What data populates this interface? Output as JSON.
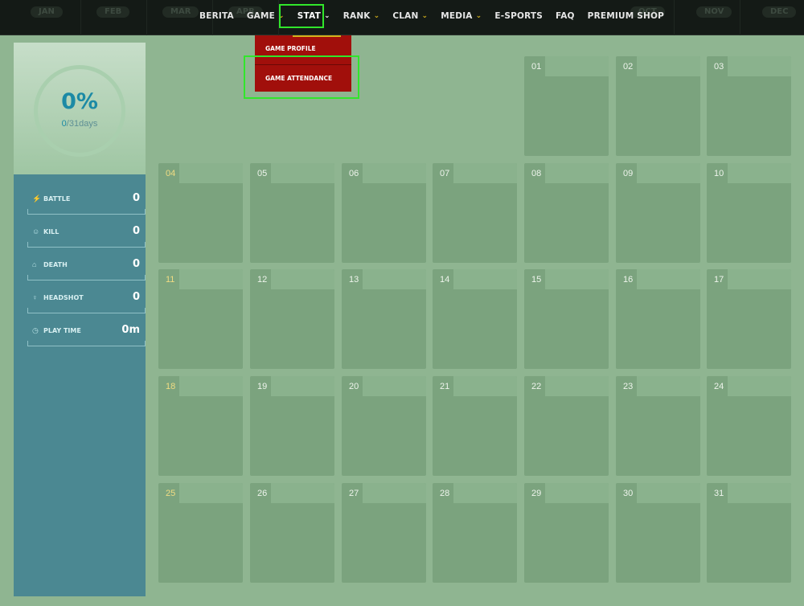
{
  "months": [
    "JAN",
    "FEB",
    "MAR",
    "APR",
    "MAY",
    "JUN",
    "JUL",
    "AUG",
    "SEP",
    "OCT",
    "NOV",
    "DEC"
  ],
  "nav": [
    {
      "label": "BERITA",
      "has_dropdown": false
    },
    {
      "label": "GAME",
      "has_dropdown": true
    },
    {
      "label": "STAT",
      "has_dropdown": true
    },
    {
      "label": "RANK",
      "has_dropdown": true
    },
    {
      "label": "CLAN",
      "has_dropdown": true
    },
    {
      "label": "MEDIA",
      "has_dropdown": true
    },
    {
      "label": "E-SPORTS",
      "has_dropdown": false
    },
    {
      "label": "FAQ",
      "has_dropdown": false
    },
    {
      "label": "PREMIUM SHOP",
      "has_dropdown": false
    }
  ],
  "dropdown": {
    "items": [
      "GAME PROFILE",
      "GAME ATTENDANCE"
    ]
  },
  "attendance": {
    "percent": "0%",
    "attended": "0",
    "total": "/31days"
  },
  "stats": [
    {
      "icon": "lightning-icon",
      "label": "BATTLE",
      "value": "0"
    },
    {
      "icon": "skull-icon",
      "label": "KILL",
      "value": "0"
    },
    {
      "icon": "tombstone-icon",
      "label": "DEATH",
      "value": "0"
    },
    {
      "icon": "head-icon",
      "label": "HEADSHOT",
      "value": "0"
    },
    {
      "icon": "clock-icon",
      "label": "PLAY TIME",
      "value": "0m"
    }
  ],
  "calendar": {
    "days": [
      "01",
      "02",
      "03",
      "04",
      "05",
      "06",
      "07",
      "08",
      "09",
      "10",
      "11",
      "12",
      "13",
      "14",
      "15",
      "16",
      "17",
      "18",
      "19",
      "20",
      "21",
      "22",
      "23",
      "24",
      "25",
      "26",
      "27",
      "28",
      "29",
      "30",
      "31"
    ],
    "weekend_days": [
      "04",
      "11",
      "18",
      "25"
    ]
  },
  "colors": {
    "accent_yellow": "#d4b21c",
    "highlight_green": "#31e62b",
    "dropdown_red": "#a10f0b",
    "attendance_teal": "#1c8aa5",
    "panel_teal": "#4b8892"
  }
}
